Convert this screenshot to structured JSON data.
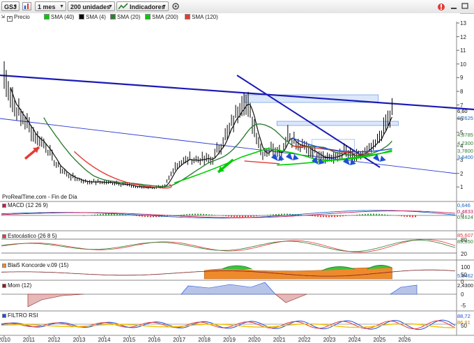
{
  "toolbar": {
    "symbol": "GSJ",
    "timeframe": "1 mes",
    "units": "200 unidades",
    "indicators": "Indicadores"
  },
  "legend": [
    {
      "label": "Precio",
      "color": "#000000"
    },
    {
      "label": "SMA (40)",
      "color": "#00cc00"
    },
    {
      "label": "SMA (4)",
      "color": "#000000"
    },
    {
      "label": "SMA (20)",
      "color": "#2e7d32"
    },
    {
      "label": "SMA (200)",
      "color": "#00cc00"
    },
    {
      "label": "SMA (120)",
      "color": "#e53935"
    }
  ],
  "main_axis_ticks": [
    "13",
    "12",
    "11",
    "10",
    "9",
    "8",
    "7",
    "6",
    "5",
    "4",
    "3",
    "2",
    "1"
  ],
  "price_tags": [
    {
      "text": "6,60",
      "color": "#000000",
      "bg": "#ffffff"
    },
    {
      "text": "6,2625",
      "color": "#1565c0",
      "bg": "#ffffff"
    },
    {
      "text": "4,8785",
      "color": "#2e7d32",
      "bg": "#ffffff"
    },
    {
      "text": "4,2300",
      "color": "#2e7d32",
      "bg": "#ffffff"
    },
    {
      "text": "3,7800",
      "color": "#2e7d32",
      "bg": "#ffffff"
    },
    {
      "text": "3,6400",
      "color": "#1565c0",
      "bg": "#ffffff"
    }
  ],
  "watermark": "ProRealTime.com - Fin de Día",
  "panels": [
    {
      "label": "MACD (12 26 9)",
      "tags": [
        "0,646",
        "0,4833",
        "0,1624"
      ],
      "ticks": [
        "0"
      ]
    },
    {
      "label": "Estocástico (26 8 5)",
      "tags": [
        "85,607",
        "85,550"
      ],
      "ticks": [
        "80",
        "20"
      ]
    },
    {
      "label": "Blai5 Koncorde v.09 (15)",
      "tags": [
        "5,6462"
      ],
      "ticks": [
        "100",
        "50",
        "0"
      ]
    },
    {
      "label": "Mom (12)",
      "tags": [
        "2,4300"
      ],
      "ticks": [
        "0",
        "-5"
      ]
    },
    {
      "label": "FILTRO RSI",
      "tags": [
        "88,72",
        "86,91"
      ],
      "ticks": [
        "50"
      ]
    }
  ],
  "x_axis": [
    "2010",
    "2011",
    "2012",
    "2013",
    "2014",
    "2015",
    "2016",
    "2017",
    "2018",
    "2019",
    "2020",
    "2021",
    "2022",
    "2023",
    "2024",
    "2025",
    "2026"
  ],
  "colors": {
    "trendline": "#1a1ab5",
    "sma_green": "#00cc00",
    "sma_dark": "#2e7d32",
    "sma_red": "#e53935",
    "arrow_red": "#e53935",
    "arrow_blue": "#1e4fd8",
    "arrow_green": "#00cc00"
  }
}
